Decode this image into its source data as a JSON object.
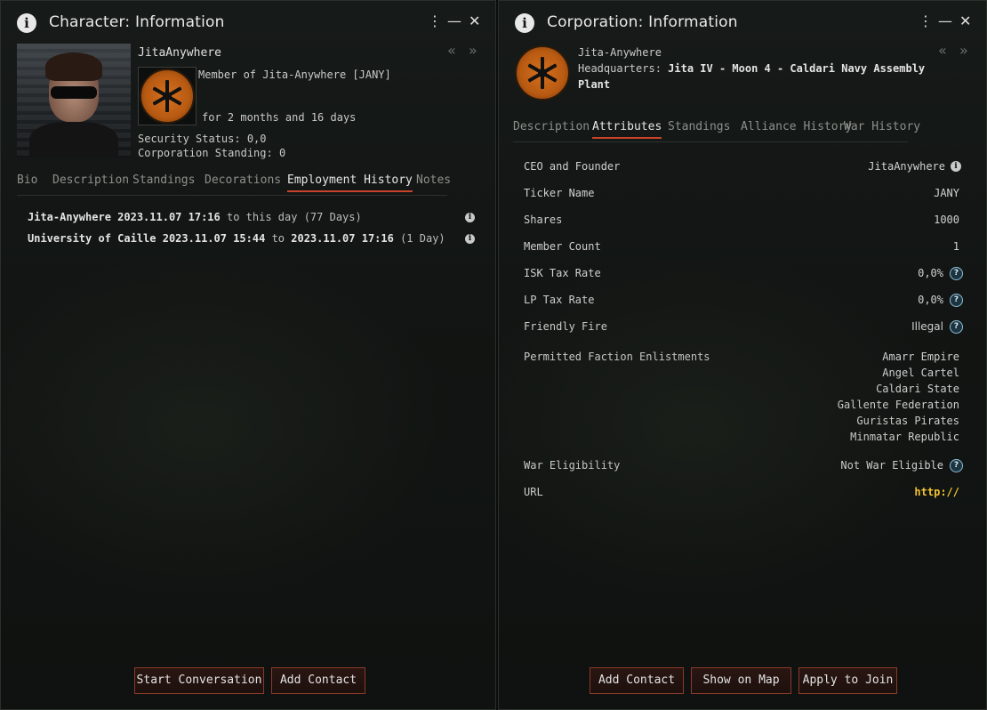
{
  "character_window": {
    "title": "Character: Information",
    "name": "JitaAnywhere",
    "member_of": "Member of Jita-Anywhere [JANY]",
    "member_duration": "for 2 months and 16 days",
    "security_status": "Security Status: 0,0",
    "corporation_standing": "Corporation Standing: 0",
    "tabs": [
      "Bio",
      "Description",
      "Standings",
      "Decorations",
      "Employment History",
      "Notes"
    ],
    "active_tab": "Employment History",
    "employment_history": [
      {
        "corp": "Jita-Anywhere",
        "start": "2023.11.07 17:16",
        "to_word": "to",
        "end": "this day",
        "duration": "(77 Days)"
      },
      {
        "corp": "University of Caille",
        "start": "2023.11.07 15:44",
        "to_word": "to",
        "end": "2023.11.07 17:16",
        "duration": "(1 Day)"
      }
    ],
    "buttons": {
      "start_conversation": "Start Conversation",
      "add_contact": "Add Contact"
    }
  },
  "corporation_window": {
    "title": "Corporation: Information",
    "name": "Jita-Anywhere",
    "headquarters_label": "Headquarters:",
    "headquarters_line1": "Jita IV - Moon 4 - Caldari Navy Assembly",
    "headquarters_line2": "Plant",
    "tabs": [
      "Description",
      "Attributes",
      "Standings",
      "Alliance History",
      "War History"
    ],
    "active_tab": "Attributes",
    "attributes": {
      "ceo_label": "CEO and Founder",
      "ceo_value": "JitaAnywhere",
      "ticker_label": "Ticker Name",
      "ticker_value": "JANY",
      "shares_label": "Shares",
      "shares_value": "1000",
      "members_label": "Member Count",
      "members_value": "1",
      "isk_tax_label": "ISK Tax Rate",
      "isk_tax_value": "0,0%",
      "lp_tax_label": "LP Tax Rate",
      "lp_tax_value": "0,0%",
      "friendly_fire_label": "Friendly Fire",
      "friendly_fire_value": "Illegal",
      "enlistments_label": "Permitted Faction Enlistments",
      "enlistments": [
        "Amarr Empire",
        "Angel Cartel",
        "Caldari State",
        "Gallente Federation",
        "Guristas Pirates",
        "Minmatar Republic"
      ],
      "war_label": "War Eligibility",
      "war_value": "Not War Eligible",
      "url_label": "URL",
      "url_value": "http://"
    },
    "buttons": {
      "add_contact": "Add Contact",
      "show_on_map": "Show on Map",
      "apply_to_join": "Apply to Join"
    }
  },
  "window_controls": {
    "menu": "⋮",
    "minimize": "—",
    "close": "✕",
    "back": "«",
    "forward": "»"
  },
  "colors": {
    "accent": "#c8432a",
    "link": "#f1c232",
    "logo_orange": "#d5711f",
    "help_blue": "#8fc1d8"
  },
  "icons": [
    "info-icon",
    "menu-icon",
    "minimize-icon",
    "close-icon",
    "back-arrow-icon",
    "forward-arrow-icon",
    "help-icon",
    "corp-logo-icon"
  ]
}
